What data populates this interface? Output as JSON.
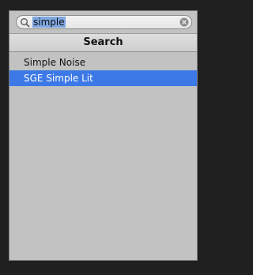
{
  "search": {
    "value": "simple",
    "icon": "search-icon",
    "clear_icon": "clear-icon"
  },
  "header": {
    "title": "Search"
  },
  "results": [
    {
      "label": "Simple Noise",
      "selected": false
    },
    {
      "label": "SGE Simple Lit",
      "selected": true
    }
  ],
  "colors": {
    "selection": "#3c79e6",
    "panel": "#c2c2c2",
    "background": "#202020"
  }
}
